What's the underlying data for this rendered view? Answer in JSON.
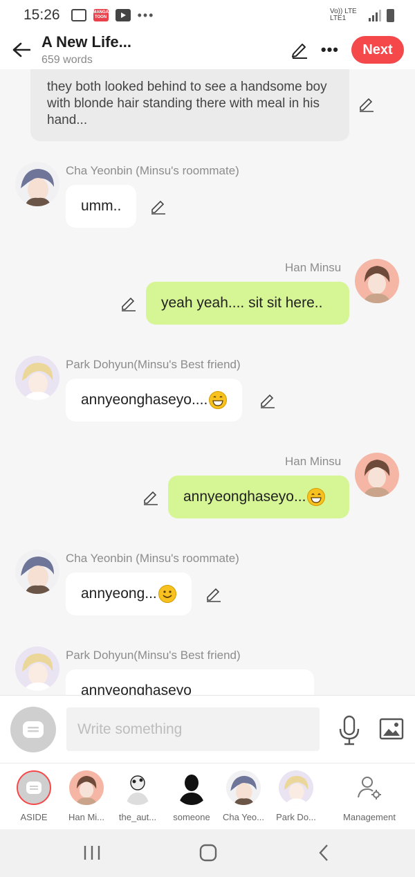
{
  "status_bar": {
    "time": "15:26",
    "manga_icon_text": "MANGA TOON",
    "network": "Vo)) LTE LTE1"
  },
  "header": {
    "title": "A New Life...",
    "word_count": "659 words",
    "next_label": "Next"
  },
  "narration": {
    "text": "they both looked behind to see a handsome boy with blonde hair standing there with meal in his hand..."
  },
  "messages": [
    {
      "side": "left",
      "sender": "Cha Yeonbin (Minsu's roommate)",
      "text": "umm.."
    },
    {
      "side": "right",
      "sender": "Han Minsu",
      "text": "yeah yeah.... sit sit here.."
    },
    {
      "side": "left",
      "sender": "Park Dohyun(Minsu's Best friend)",
      "text": "annyeonghaseyo....",
      "emoji": "grinning-face"
    },
    {
      "side": "right",
      "sender": "Han Minsu",
      "text": "annyeonghaseyo...",
      "emoji": "beaming-face"
    },
    {
      "side": "left",
      "sender": "Cha Yeonbin (Minsu's roommate)",
      "text": "annyeong...",
      "emoji": "smiling-face"
    },
    {
      "side": "left",
      "sender": "Park Dohyun(Minsu's Best friend)",
      "text": "annyeonghaseyo"
    }
  ],
  "input": {
    "placeholder": "Write something"
  },
  "characters": [
    {
      "label": "ASIDE"
    },
    {
      "label": "Han Mi..."
    },
    {
      "label": "the_aut..."
    },
    {
      "label": "someone"
    },
    {
      "label": "Cha Yeo..."
    },
    {
      "label": "Park Do..."
    },
    {
      "label": "Management"
    }
  ],
  "colors": {
    "accent": "#f5484b",
    "right_bubble": "#d6f594",
    "left_bubble": "#ffffff"
  }
}
